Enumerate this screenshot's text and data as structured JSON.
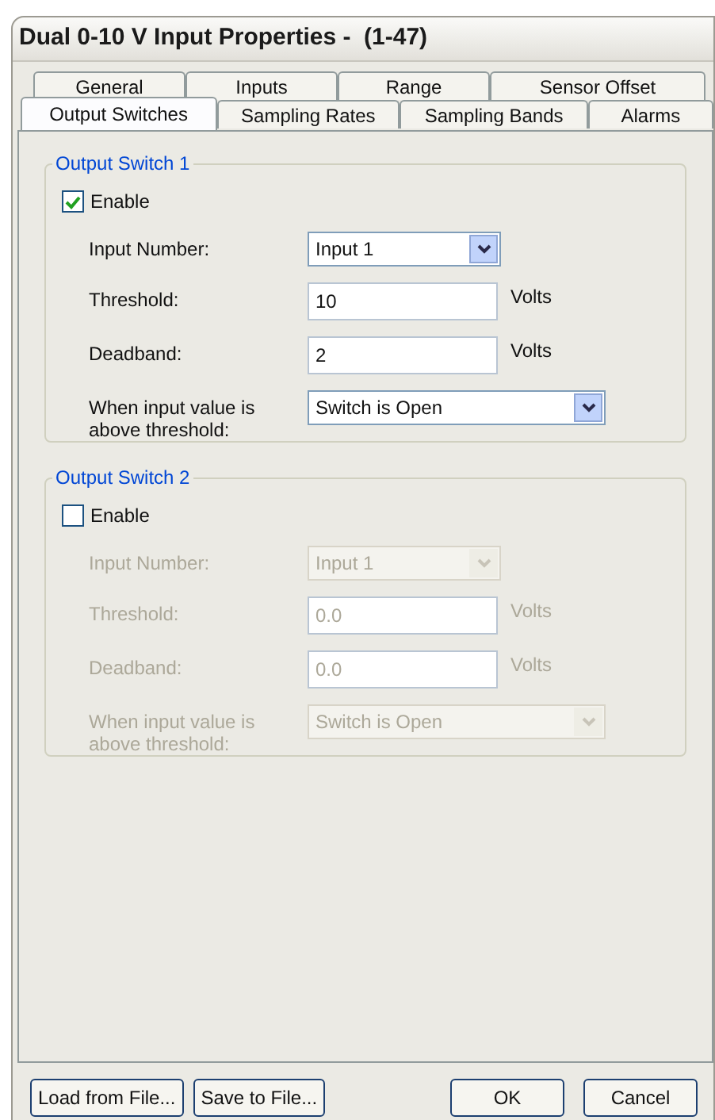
{
  "window": {
    "title": "Dual 0-10 V Input Properties -  (1-47)"
  },
  "tab_rows": [
    [
      {
        "label": "General",
        "selected": false
      },
      {
        "label": "Inputs",
        "selected": false
      },
      {
        "label": "Range",
        "selected": false
      },
      {
        "label": "Sensor Offset",
        "selected": false
      }
    ],
    [
      {
        "label": "Output Switches",
        "selected": true
      },
      {
        "label": "Sampling Rates",
        "selected": false
      },
      {
        "label": "Sampling Bands",
        "selected": false
      },
      {
        "label": "Alarms",
        "selected": false
      }
    ]
  ],
  "groups": [
    {
      "title": "Output Switch 1",
      "enable": {
        "label": "Enable",
        "checked": true
      },
      "disabled": false,
      "fields": [
        {
          "kind": "dropdown",
          "label": "Input Number:",
          "value": "Input 1",
          "wide": false
        },
        {
          "kind": "text",
          "label": "Threshold:",
          "value": "10",
          "unit": "Volts"
        },
        {
          "kind": "text",
          "label": "Deadband:",
          "value": "2",
          "unit": "Volts"
        },
        {
          "kind": "dropdown",
          "label": "When input value is above threshold:",
          "value": "Switch is Open",
          "wide": true
        }
      ]
    },
    {
      "title": "Output Switch 2",
      "enable": {
        "label": "Enable",
        "checked": false
      },
      "disabled": true,
      "fields": [
        {
          "kind": "dropdown",
          "label": "Input Number:",
          "value": "Input 1",
          "wide": false
        },
        {
          "kind": "text",
          "label": "Threshold:",
          "value": "0.0",
          "unit": "Volts"
        },
        {
          "kind": "text",
          "label": "Deadband:",
          "value": "0.0",
          "unit": "Volts"
        },
        {
          "kind": "dropdown",
          "label": "When input value is above threshold:",
          "value": "Switch is Open",
          "wide": true
        }
      ]
    }
  ],
  "buttons_left": [
    "Load from File...",
    "Save to File..."
  ],
  "buttons_right": [
    "OK",
    "Cancel"
  ]
}
